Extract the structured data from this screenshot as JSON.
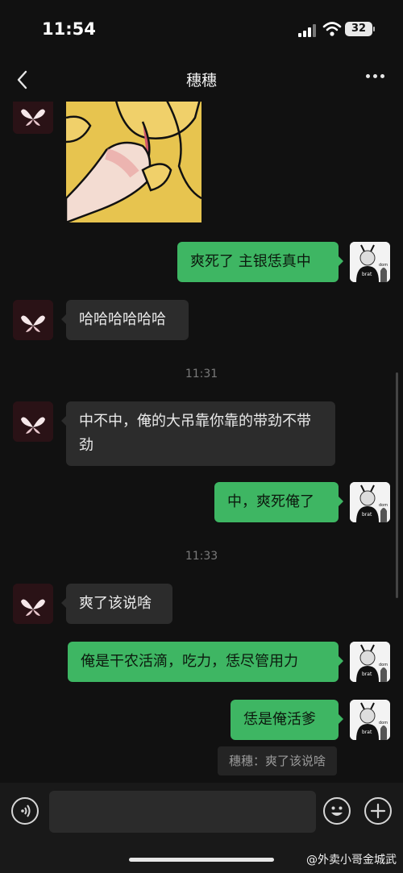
{
  "status_bar": {
    "time": "11:54",
    "battery": "32"
  },
  "nav": {
    "title": "穗穗"
  },
  "messages": [
    {
      "side": "in",
      "text": "哈哈哈哈哈哈"
    },
    {
      "side": "out",
      "text": "爽死了 主银恁真中"
    },
    {
      "side": "in",
      "text": "中不中，俺的大吊靠你靠的带劲不带劲"
    },
    {
      "side": "out",
      "text": "中，爽死俺了"
    },
    {
      "side": "in",
      "text": "爽了该说啥"
    },
    {
      "side": "out",
      "text": "俺是干农活滴，吃力，恁尽管用力"
    },
    {
      "side": "out",
      "text": "恁是俺活爹"
    }
  ],
  "timestamps": [
    "11:31",
    "11:33"
  ],
  "quote": "穗穗：爽了该说啥",
  "avatar_text": {
    "shirt": "brat",
    "corner": "dom"
  },
  "input_bar": {
    "voice_icon": "voice-icon",
    "emoji_icon": "emoji-icon",
    "add_icon": "plus-icon"
  },
  "watermark": "@外卖小哥金城武",
  "colors": {
    "bubble_out": "#3eb663",
    "bubble_in": "#2c2c2c",
    "background": "#111111"
  }
}
